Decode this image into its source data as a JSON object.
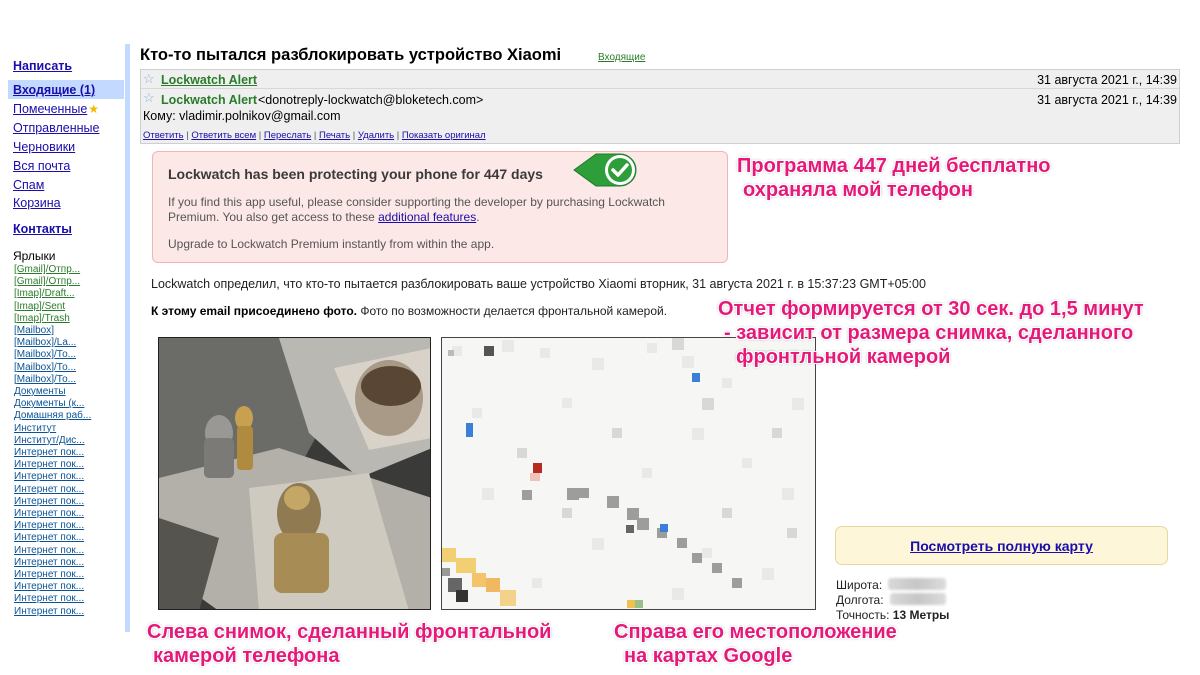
{
  "sidebar": {
    "compose": "Написать",
    "inbox": "Входящие (1)",
    "starred": "Помеченные",
    "sent": "Отправленные",
    "drafts": "Черновики",
    "all_mail": "Вся почта",
    "spam": "Спам",
    "trash": "Корзина",
    "contacts": "Контакты",
    "labels_title": "Ярлыки",
    "labels": [
      "[Gmail]/Отпр...",
      "[Gmail]/Отпр...",
      "[Imap]/Draft...",
      "[Imap]/Sent",
      "[Imap]/Trash",
      "[Mailbox]",
      "[Mailbox]/La...",
      "[Mailbox]/То...",
      "[Mailbox]/То...",
      "[Mailbox]/То...",
      "Документы",
      "Документы (к...",
      "Домашняя раб...",
      "Институт",
      "Институт/Дис...",
      "Интернет пок...",
      "Интернет пок...",
      "Интернет пок...",
      "Интернет пок...",
      "Интернет пок...",
      "Интернет пок...",
      "Интернет пок...",
      "Интернет пок...",
      "Интернет пок...",
      "Интернет пок...",
      "Интернет пок...",
      "Интернет пок...",
      "Интернет пок...",
      "Интернет пок..."
    ]
  },
  "email": {
    "subject": "Кто-то пытался разблокировать устройство Xiaomi",
    "folder_link": "Входящие",
    "row1_sender": "Lockwatch Alert",
    "row1_date": "31 августа 2021 г., 14:39",
    "row2_sender": "Lockwatch Alert",
    "row2_email": "<donotreply-lockwatch@bloketech.com>",
    "row2_date": "31 августа 2021 г., 14:39",
    "to": "Кому: vladimir.polnikov@gmail.com",
    "actions": [
      "Ответить",
      "Ответить всем",
      "Переслать",
      "Печать",
      "Удалить",
      "Показать оригинал"
    ]
  },
  "alert": {
    "title": "Lockwatch has been protecting your phone for 447 days",
    "text_before_link": "If you find this app useful, please consider supporting the developer by purchasing Lockwatch Premium. You also get access to these ",
    "link": "additional features",
    "text_after_link": ".",
    "upgrade": "Upgrade to Lockwatch Premium instantly from within the app."
  },
  "body": {
    "detect_line": "Lockwatch определил, что кто-то пытается разблокировать ваше устройство Xiaomi вторник, 31 августа 2021 г. в 15:37:23 GMT+05:00",
    "photo_bold": "К этому email присоединено фото.",
    "photo_rest": " Фото по возможности делается фронтальной камерой."
  },
  "location": {
    "map_button": "Посмотреть полную карту",
    "latitude_label": "Широта:",
    "longitude_label": "Долгота:",
    "accuracy_label": "Точность:",
    "accuracy_value": "13 Метры"
  },
  "annotations": {
    "a1_line1": "Программа 447 дней бесплатно",
    "a1_line2": "охраняла мой телефон",
    "a2_line1": "Отчет формируется от 30 сек. до 1,5 минут",
    "a2_line2": "- зависит от размера снимка, сделанного",
    "a2_line3": "фронтльной камерой",
    "a3_line1": "Слева снимок, сделанный фронтальной",
    "a3_line2": "камерой телефона",
    "a4_line1": "Справа его местоположение",
    "a4_line2": "на картах Google"
  },
  "colors": {
    "link_blue": "#1a0dab",
    "sender_green": "#2a7c2a",
    "annotation_pink": "#e6187a",
    "badge_green": "#2e9e3a"
  }
}
